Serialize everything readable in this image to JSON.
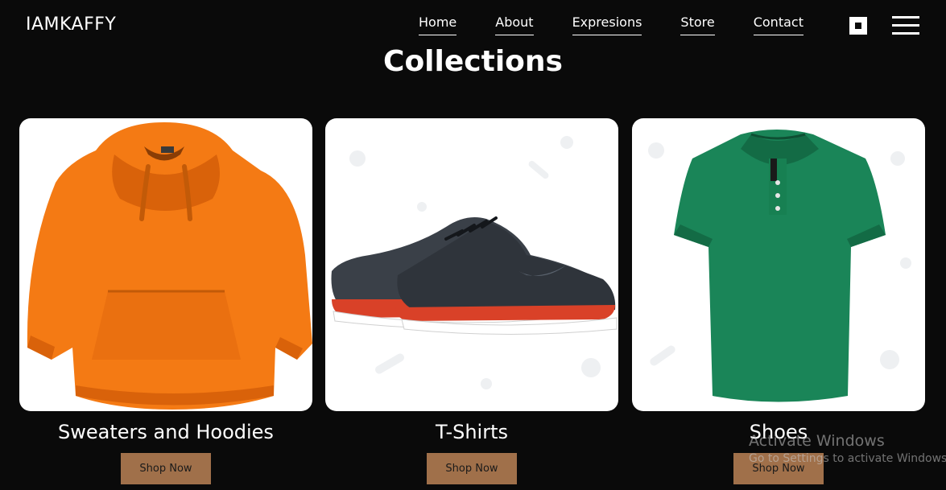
{
  "brand": "IAMKAFFY",
  "nav": [
    "Home",
    "About",
    "Expresions",
    "Store",
    "Contact"
  ],
  "title": "Collections",
  "cards": [
    {
      "title": "Sweaters and Hoodies",
      "button": "Shop Now"
    },
    {
      "title": "T-Shirts",
      "button": "Shop Now"
    },
    {
      "title": "Shoes",
      "button": "Shop Now"
    }
  ],
  "watermark": {
    "title": "Activate Windows",
    "sub": "Go to Settings to activate Windows."
  },
  "colors": {
    "background": "#0a0a0a",
    "button": "#a0704a",
    "hoodie": "#f47a14",
    "polo": "#1a8558",
    "sneaker": "#3a4048",
    "sole_accent": "#d94128"
  },
  "icons": [
    "square-icon",
    "hamburger-menu-icon"
  ]
}
